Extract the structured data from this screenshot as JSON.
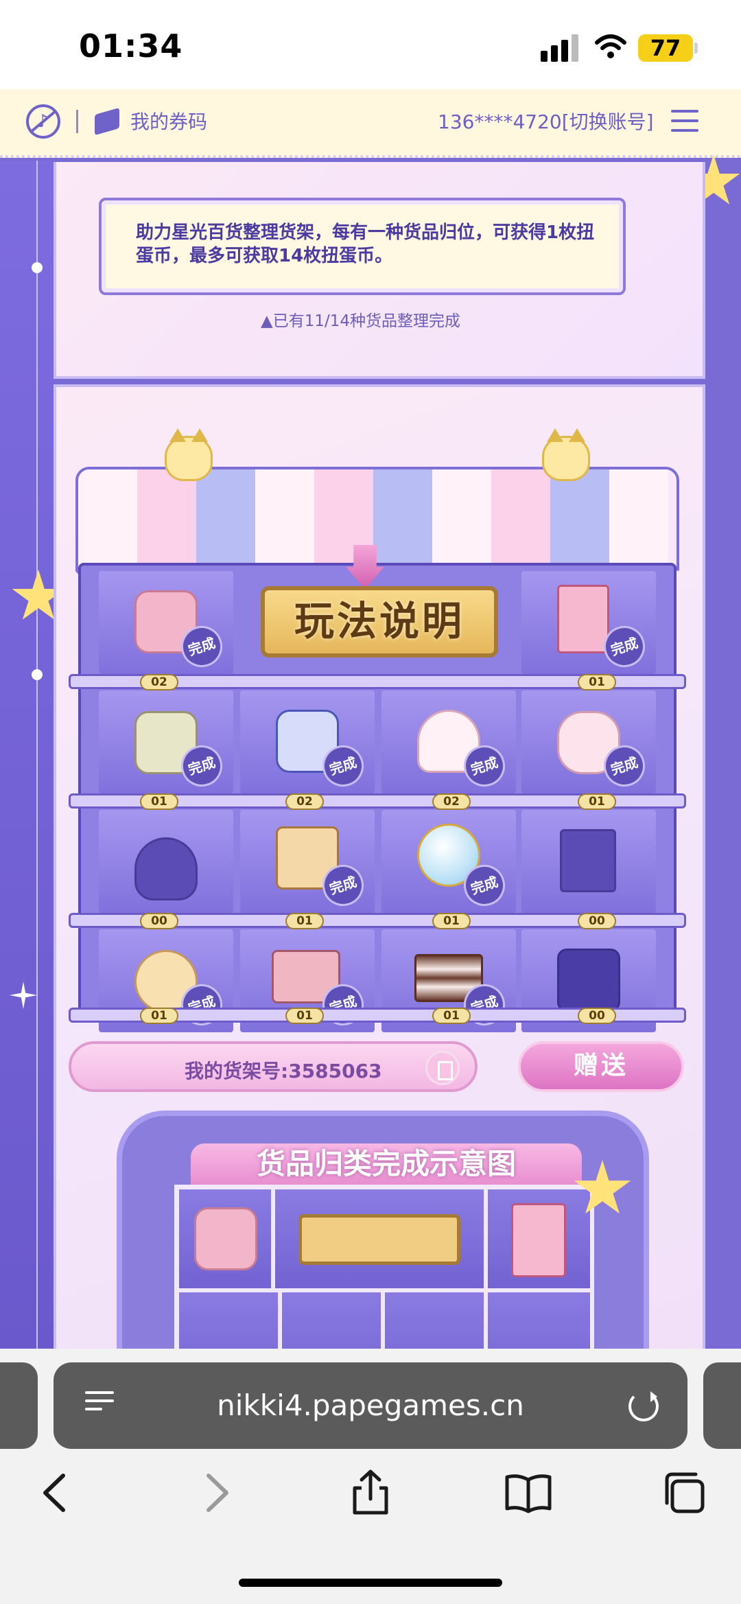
{
  "status_bar": {
    "time": "01:34",
    "battery": "77"
  },
  "nav": {
    "coupon_label": "我的券码",
    "account": "136****4720[切换账号]"
  },
  "info": {
    "description": "助力星光百货整理货架，每有一种货品归位，可获得1枚扭蛋币，最多可获取14枚扭蛋币。",
    "progress": "▲已有11/14种货品整理完成"
  },
  "shelf": {
    "howto_label": "玩法说明",
    "done_label": "完成",
    "rows": [
      [
        {
          "item": "rabbit-backpack",
          "count": "02",
          "done": true
        },
        {
          "item": "howto-sign",
          "count": "",
          "done": false
        },
        {
          "item": "photo-album",
          "count": "01",
          "done": true
        }
      ],
      [
        {
          "item": "flower-basket",
          "count": "01",
          "done": true
        },
        {
          "item": "bow-perfume",
          "count": "02",
          "done": true
        },
        {
          "item": "seashell",
          "count": "02",
          "done": true
        },
        {
          "item": "bunny-mug",
          "count": "01",
          "done": true
        }
      ],
      [
        {
          "item": "cat-hat",
          "count": "00",
          "done": false
        },
        {
          "item": "suitcase",
          "count": "01",
          "done": true
        },
        {
          "item": "crystal-ball",
          "count": "01",
          "done": true
        },
        {
          "item": "milk-carton",
          "count": "00",
          "done": false
        }
      ],
      [
        {
          "item": "moon-pillow",
          "count": "01",
          "done": true
        },
        {
          "item": "makeup-palette",
          "count": "01",
          "done": true
        },
        {
          "item": "cake-slice",
          "count": "01",
          "done": true
        },
        {
          "item": "camera",
          "count": "00",
          "done": false
        }
      ]
    ]
  },
  "shelf_number": {
    "label": "我的货架号:3585063"
  },
  "gift_button": {
    "label": "赠送"
  },
  "demo": {
    "title": "货品归类完成示意图"
  },
  "browser": {
    "url": "nikki4.papegames.cn"
  },
  "colors": {
    "accent": "#7a6ad4",
    "awning_pink": "#fbd2ea",
    "awning_blue": "#b8bdf3",
    "badge": "#5e4fb8"
  }
}
